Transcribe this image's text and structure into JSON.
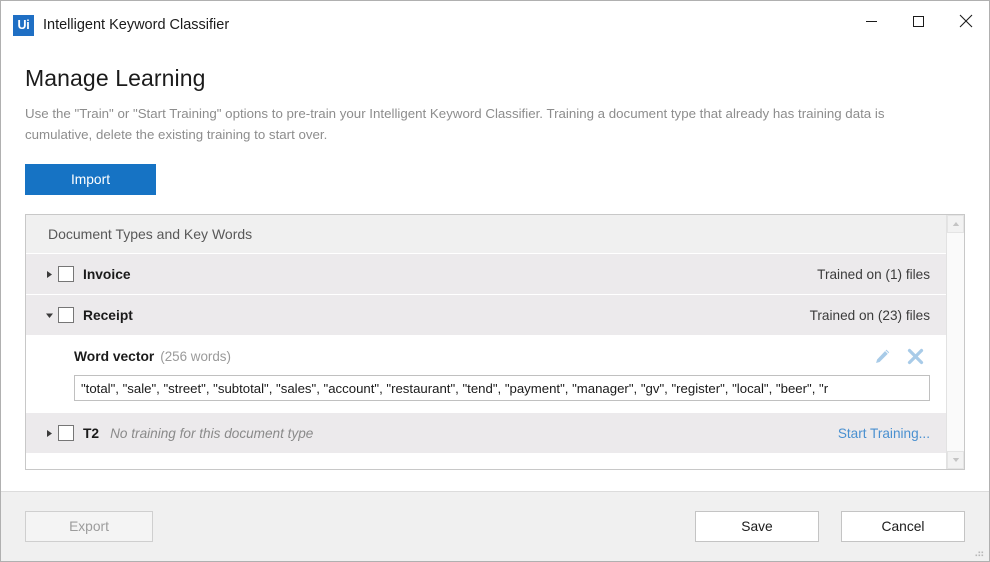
{
  "window": {
    "app_logo_text": "Ui",
    "title": "Intelligent Keyword Classifier",
    "controls": {
      "minimize": "minimize-icon",
      "maximize": "maximize-icon",
      "close": "close-icon"
    }
  },
  "page": {
    "title": "Manage Learning",
    "description": "Use the \"Train\" or \"Start Training\" options to pre-train your Intelligent Keyword Classifier. Training a document type that already has training data is cumulative, delete the existing training to start over.",
    "import_label": "Import"
  },
  "list": {
    "header": "Document Types and Key Words",
    "rows": [
      {
        "name": "Invoice",
        "expanded": false,
        "checked": false,
        "status": "Trained on (1) files",
        "note": "",
        "link": ""
      },
      {
        "name": "Receipt",
        "expanded": true,
        "checked": false,
        "status": "Trained on (23) files",
        "note": "",
        "link": ""
      },
      {
        "name": "T2",
        "expanded": false,
        "checked": false,
        "status": "",
        "note": "No training for this document type",
        "link": "Start Training..."
      }
    ],
    "detail": {
      "label": "Word vector",
      "count": "(256 words)",
      "edit_icon": "pencil-icon",
      "delete_icon": "close-x-icon",
      "value": "\"total\", \"sale\", \"street\", \"subtotal\", \"sales\", \"account\", \"restaurant\", \"tend\", \"payment\", \"manager\", \"gv\", \"register\", \"local\", \"beer\", \"r",
      "placeholder": ""
    },
    "scrollbar": {
      "up_icon": "chevron-up-icon",
      "down_icon": "chevron-down-icon"
    }
  },
  "footer": {
    "export_label": "Export",
    "save_label": "Save",
    "cancel_label": "Cancel"
  },
  "colors": {
    "accent": "#1673c4",
    "link": "#4a90d0",
    "icon_blue": "#a8cbe8",
    "row_bg": "#eceaec",
    "header_bg": "#f0f0f0"
  }
}
